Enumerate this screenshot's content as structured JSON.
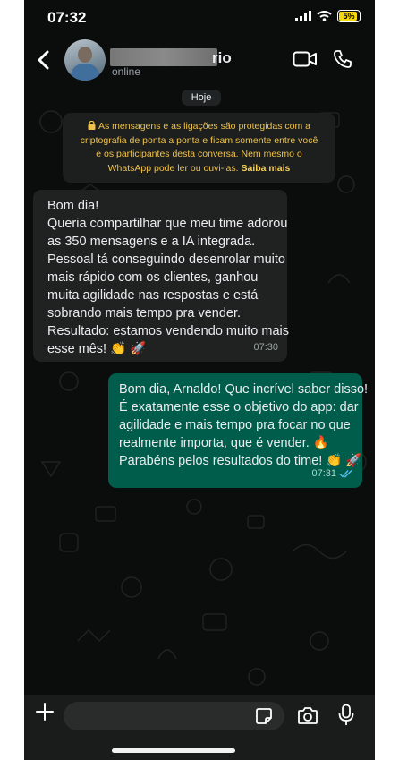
{
  "status_bar": {
    "time": "07:32",
    "battery": "5%"
  },
  "header": {
    "contact_name": "rio",
    "contact_status": "online"
  },
  "date_chip": "Hoje",
  "encryption_notice": {
    "lines": [
      "As mensagens e as ligações são protegidas com a",
      "criptografia de ponta a ponta e ficam somente entre você",
      "e os participantes desta conversa. Nem mesmo o",
      "WhatsApp pode ler ou ouvi-las."
    ],
    "link": "Saiba mais"
  },
  "messages": [
    {
      "direction": "incoming",
      "lines": [
        "Bom dia!",
        "Queria compartilhar que meu time adorou",
        "as 350 mensagens e a IA integrada.",
        "Pessoal tá conseguindo desenrolar muito",
        "mais rápido com os clientes, ganhou",
        "muita agilidade nas respostas e está",
        "sobrando mais tempo pra vender.",
        "Resultado: estamos vendendo muito mais",
        "esse mês! 👏 🚀"
      ],
      "time": "07:30"
    },
    {
      "direction": "outgoing",
      "lines": [
        "Bom dia, Arnaldo! Que incrível saber disso!",
        "É exatamente esse o objetivo do app: dar",
        "agilidade e mais tempo pra focar no que",
        "realmente importa, que é vender. 🔥",
        "Parabéns pelos resultados do time! 👏 🚀"
      ],
      "time": "07:31",
      "read": true
    }
  ],
  "composer": {
    "value": ""
  },
  "colors": {
    "background": "#0b0d0c",
    "incoming_bubble": "#202222",
    "outgoing_bubble": "#005c4b",
    "notice_text": "#f0c24b",
    "read_ticks": "#53bdeb"
  }
}
